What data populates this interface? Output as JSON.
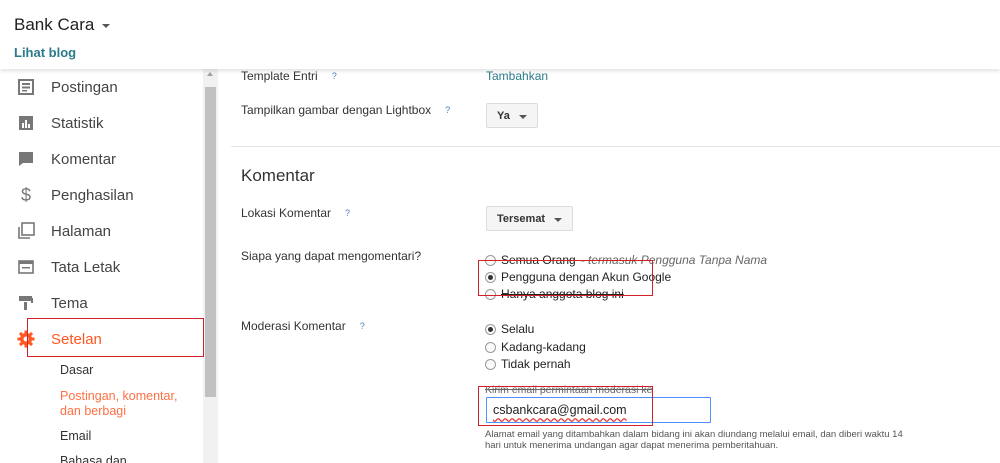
{
  "header": {
    "blog_title": "Bank Cara",
    "view_blog": "Lihat blog"
  },
  "sidebar": {
    "items": [
      {
        "label": "Postingan",
        "icon": "posts-icon"
      },
      {
        "label": "Statistik",
        "icon": "stats-icon"
      },
      {
        "label": "Komentar",
        "icon": "comments-icon"
      },
      {
        "label": "Penghasilan",
        "icon": "dollar-icon"
      },
      {
        "label": "Halaman",
        "icon": "pages-icon"
      },
      {
        "label": "Tata Letak",
        "icon": "layout-icon"
      },
      {
        "label": "Tema",
        "icon": "theme-icon"
      },
      {
        "label": "Setelan",
        "icon": "gear-icon",
        "active": true
      }
    ],
    "sub_items": [
      {
        "label": "Dasar"
      },
      {
        "label": "Postingan, komentar, dan berbagi",
        "line1": "Postingan, komentar,",
        "line2": "dan berbagi",
        "active": true
      },
      {
        "label": "Email"
      },
      {
        "label": "Bahasa dan"
      }
    ]
  },
  "main": {
    "template_entry": {
      "label": "Template Entri",
      "help": "?",
      "action": "Tambahkan"
    },
    "lightbox": {
      "label": "Tampilkan gambar dengan Lightbox",
      "help": "?",
      "value": "Ya"
    },
    "comments_section": {
      "title": "Komentar",
      "location": {
        "label": "Lokasi Komentar",
        "help": "?",
        "value": "Tersemat"
      },
      "who_can_comment": {
        "label": "Siapa yang dapat mengomentari?",
        "options": [
          {
            "label": "Semua Orang",
            "note": "- termasuk Pengguna Tanpa Nama",
            "selected": false
          },
          {
            "label": "Pengguna dengan Akun Google",
            "selected": true
          },
          {
            "label": "Hanya anggota blog ini",
            "selected": false
          }
        ]
      },
      "moderation": {
        "label": "Moderasi Komentar",
        "help": "?",
        "options": [
          {
            "label": "Selalu",
            "selected": true
          },
          {
            "label": "Kadang-kadang",
            "selected": false
          },
          {
            "label": "Tidak pernah",
            "selected": false
          }
        ],
        "email_label": "Kirim email permintaan moderasi ke",
        "email_value": "csbankcara@gmail.com",
        "hint": "Alamat email yang ditambahkan dalam bidang ini akan diundang melalui email, dan diberi waktu 14 hari untuk menerima undangan agar dapat menerima pemberitahuan."
      }
    }
  },
  "colors": {
    "accent": "#ff5722",
    "link": "#2a7c8a",
    "highlight_box": "#d0212a",
    "input_focus": "#4d90fe"
  }
}
